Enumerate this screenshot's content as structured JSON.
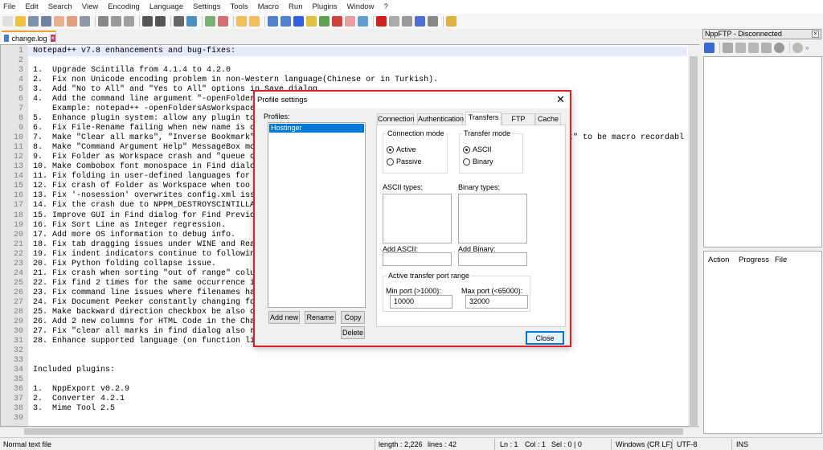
{
  "menu": [
    "File",
    "Edit",
    "Search",
    "View",
    "Encoding",
    "Language",
    "Settings",
    "Tools",
    "Macro",
    "Run",
    "Plugins",
    "Window",
    "?"
  ],
  "tab": {
    "label": "change.log"
  },
  "editor": {
    "lines": [
      "Notepad++ v7.8 enhancements and bug-fixes:",
      "",
      "1.  Upgrade Scintilla from 4.1.4 to 4.2.0",
      "2.  Fix non Unicode encoding problem in non-Western language(Chinese or in Turkish).",
      "3.  Add \"No to All\" and \"Yes to All\" options in Save dialog",
      "4.  Add the command line argument \"-openFolder",
      "    Example: notepad++ -openFoldersAsWorkspace",
      "5.  Enhance plugin system: allow any plugin to",
      "6.  Fix File-Rename failing when new name is c",
      "7.  Make \"Clear all marks\", \"Inverse Bookmark\"",
      "8.  Make \"Command Argument Help\" MessageBox mo",
      "9.  Fix Folder as Workspace crash and \"queue c",
      "10. Make Combobox font monospace in Find dialo",
      "11. Fix folding in user-defined languages for",
      "12. Fix crash of Folder as Workspace when too",
      "13. Fix '-nosession' overwrites config.xml iss",
      "14. Fix the crash due to NPPM_DESTROYSCINTILLA",
      "15. Improve GUI in Find dialog for Find Previo",
      "16. Fix Sort Line as Integer regression.",
      "17. Add more OS information to debug info.",
      "18. Fix tab dragging issues under WINE and Rea",
      "19. Fix indent indicators continue to followin",
      "20. Fix Python folding collapse issue.",
      "21. Fix crash when sorting \"out of range\" colu",
      "22. Fix find 2 times for the same occurrence i",
      "23. Fix command line issues where filenames ha",
      "24. Fix Document Peeker constantly changing fo",
      "25. Make backward direction checkbox be also c",
      "26. Add 2 new columns for HTML Code in the Cha",
      "27. Fix \"clear all marks in find dialog also r",
      "28. Enhance supported language (on function li",
      "",
      "",
      "Included plugins:",
      "",
      "1.  NppExport v0.2.9",
      "2.  Converter 4.2.1",
      "3.  Mime Tool 2.5",
      ""
    ],
    "line10_tail": "t\" to be macro recordabl"
  },
  "ftp_panel": {
    "title": "NppFTP - Disconnected",
    "queue_columns": [
      "Action",
      "Progress",
      "File"
    ]
  },
  "dialog": {
    "title": "Profile settings",
    "profiles_label": "Profiles:",
    "profiles": [
      "Hostinger"
    ],
    "buttons": {
      "add_new": "Add new",
      "rename": "Rename",
      "copy": "Copy",
      "delete": "Delete",
      "close": "Close"
    },
    "tabs": [
      "Connection",
      "Authentication",
      "Transfers",
      "FTP Misc.",
      "Cache"
    ],
    "active_tab": "Transfers",
    "connection_mode": {
      "label": "Connection mode",
      "options": [
        "Active",
        "Passive"
      ],
      "selected": "Active"
    },
    "transfer_mode": {
      "label": "Transfer mode",
      "options": [
        "ASCII",
        "Binary"
      ],
      "selected": "ASCII"
    },
    "ascii_types_label": "ASCII types:",
    "binary_types_label": "Binary types:",
    "add_ascii_label": "Add ASCII:",
    "add_binary_label": "Add Binary:",
    "port_range": {
      "label": "Active transfer port range",
      "min_label": "Min port (>1000):",
      "min_value": "10000",
      "max_label": "Max port (<65000):",
      "max_value": "32000"
    }
  },
  "status": {
    "file_type": "Normal text file",
    "length": "length : 2,226",
    "lines": "lines : 42",
    "ln": "Ln : 1",
    "col": "Col : 1",
    "sel": "Sel : 0 | 0",
    "eol": "Windows (CR LF)",
    "encoding": "UTF-8",
    "mode": "INS"
  },
  "colors": {
    "dialog_border": "#e0202a",
    "selection": "#0078d7",
    "current_line": "#e8e8ff"
  }
}
